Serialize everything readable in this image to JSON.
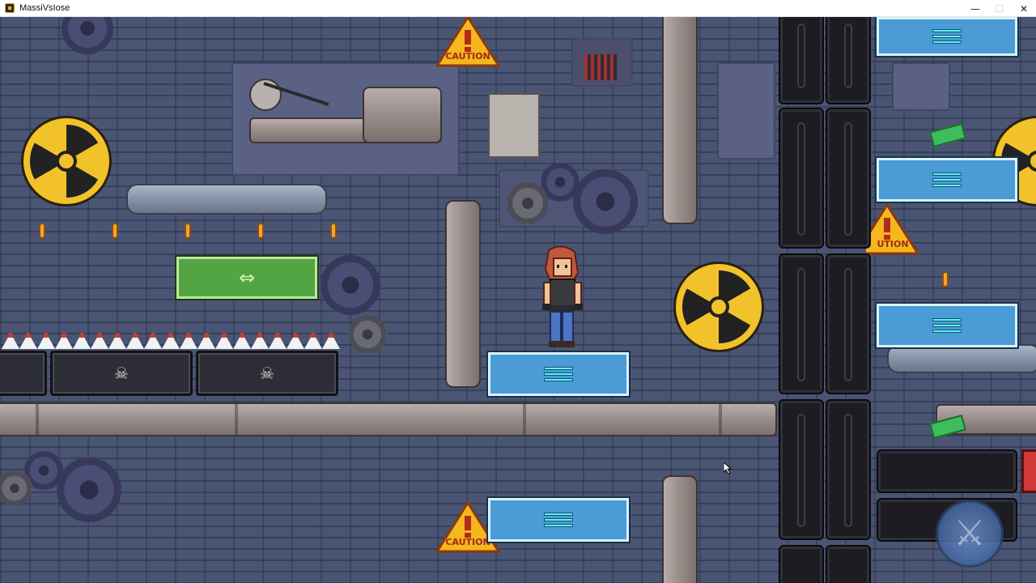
{
  "window": {
    "title": "MassiVsIose",
    "minimize": "—",
    "maximize": "☐",
    "close": "✕"
  },
  "game": {
    "caution_label": "CAUTION",
    "caution_label_cut": "UTION",
    "arrow_glyph": "⇔",
    "skull_glyph": "☠",
    "attack_button_glyph": "⚔"
  }
}
